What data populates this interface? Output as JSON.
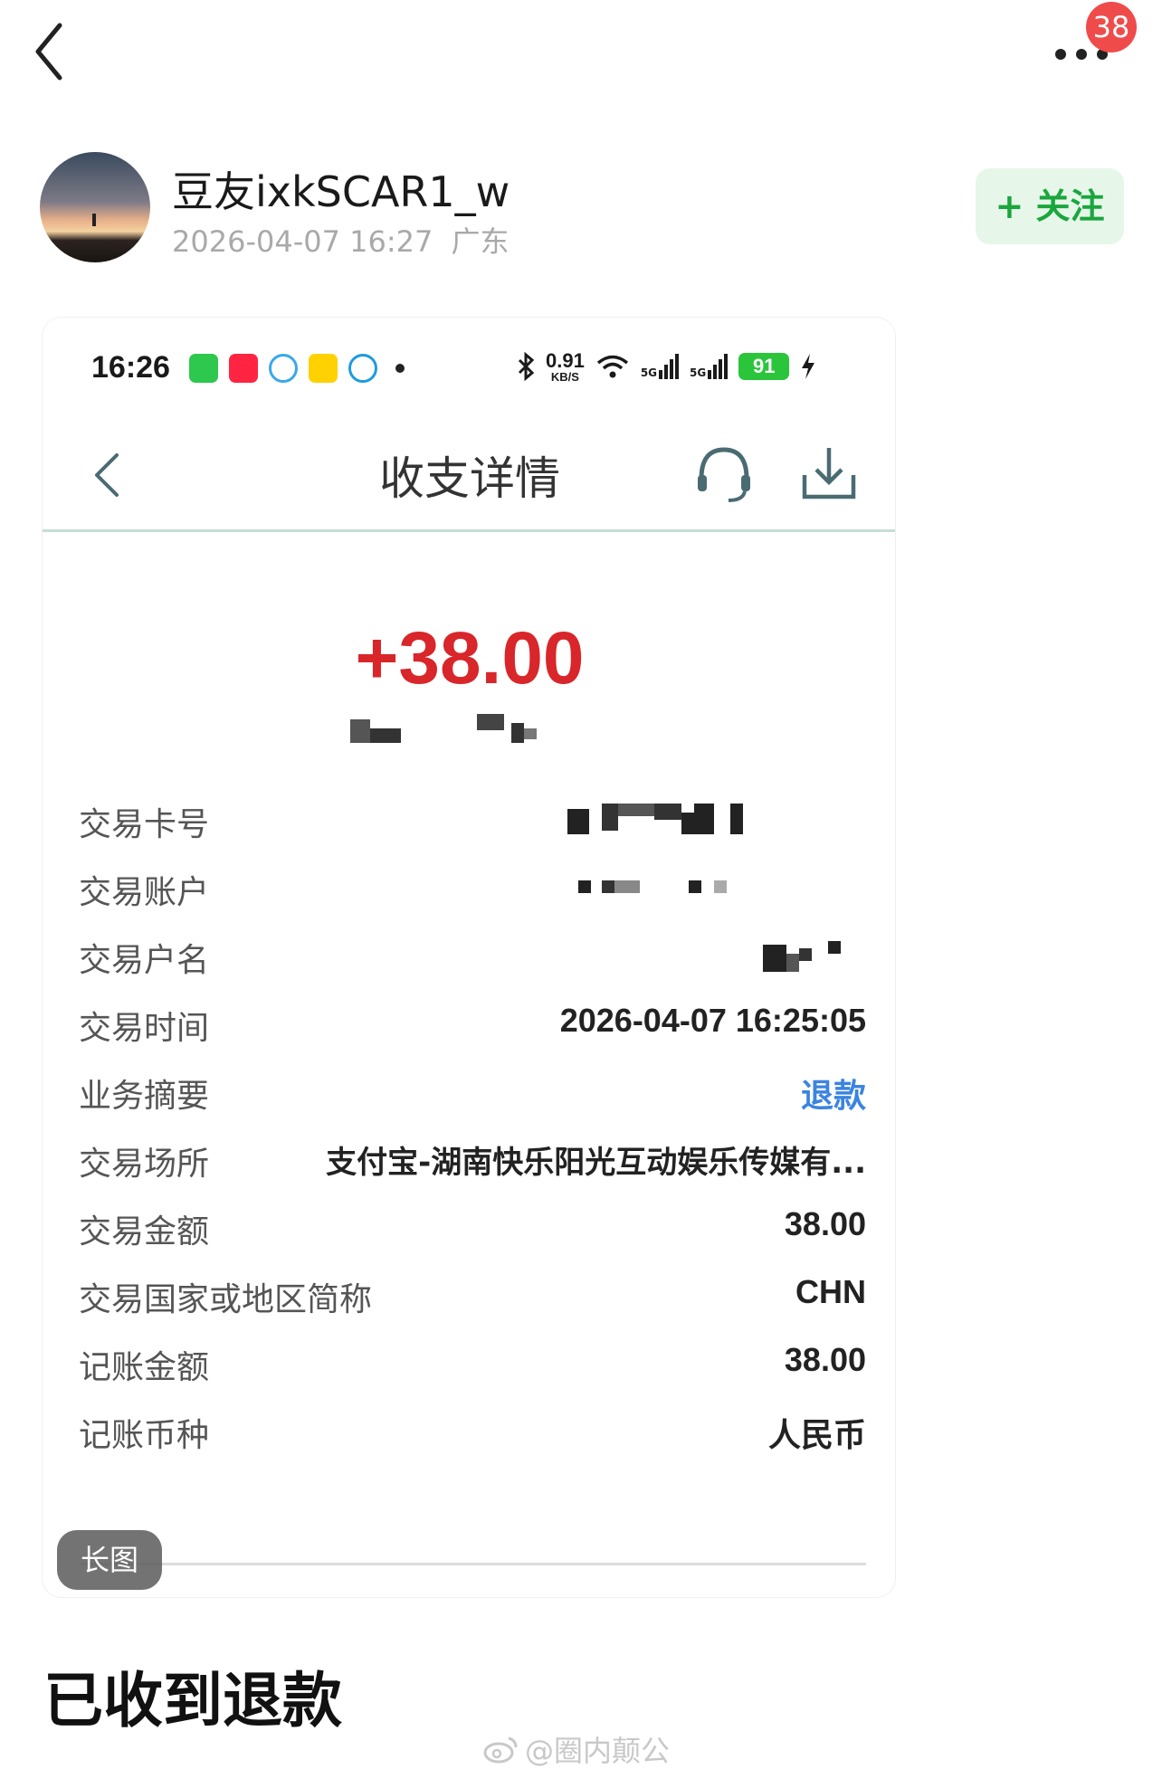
{
  "header": {
    "notification_count": "38"
  },
  "author": {
    "name": "豆友ixkSCAR1_w",
    "post_time": "2026-04-07 16:27",
    "location": "广东",
    "follow_label": "+ 关注"
  },
  "screenshot": {
    "status_bar": {
      "time": "16:26",
      "net_speed": "0.91",
      "net_unit": "KB/S",
      "signal1": "5G",
      "signal2": "5G",
      "battery": "91",
      "app_icons": [
        "wechat-icon",
        "xiaohongshu-icon",
        "message-icon",
        "meituan-icon",
        "mobile-icon"
      ]
    },
    "title": "收支详情",
    "amount": "+38.00",
    "rows": [
      {
        "label": "交易卡号",
        "value": ""
      },
      {
        "label": "交易账户",
        "value": ""
      },
      {
        "label": "交易户名",
        "value": ""
      },
      {
        "label": "交易时间",
        "value": "2026-04-07 16:25:05"
      },
      {
        "label": "业务摘要",
        "value": "退款"
      },
      {
        "label": "交易场所",
        "value": "支付宝-湖南快乐阳光互动娱乐传媒有..."
      },
      {
        "label": "交易金额",
        "value": "38.00"
      },
      {
        "label": "交易国家或地区简称",
        "value": "CHN"
      },
      {
        "label": "记账金额",
        "value": "38.00"
      },
      {
        "label": "记账币种",
        "value": "人民币"
      }
    ],
    "long_image_tag": "长图"
  },
  "post": {
    "title": "已收到退款"
  },
  "watermark": "@圈内颠公",
  "colors": {
    "amount": "#d8262a",
    "link": "#3b84e0",
    "follow": "#1aa63c",
    "badge": "#f04b4b"
  }
}
